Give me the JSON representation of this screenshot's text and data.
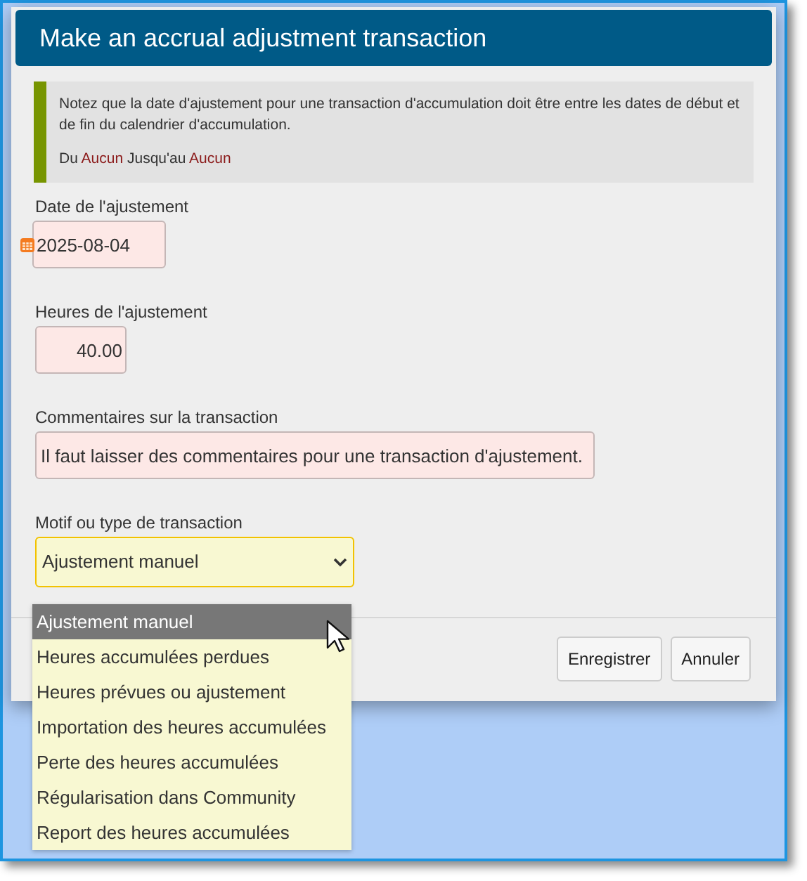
{
  "dialog": {
    "title": "Make an accrual adjustment transaction"
  },
  "notice": {
    "text": "Notez que la date d'ajustement pour une transaction d'accumulation doit être entre les dates de début et de fin du calendrier d'accumulation.",
    "range": [
      {
        "kind": "plain",
        "text": "Du"
      },
      {
        "kind": "value",
        "text": "Aucun"
      },
      {
        "kind": "plain",
        "text": "Jusqu'au"
      },
      {
        "kind": "value",
        "text": "Aucun"
      }
    ]
  },
  "fields": [
    {
      "kind": "date",
      "label": "Date de l'ajustement",
      "value": "2025-08-04"
    },
    {
      "kind": "number",
      "label": "Heures de l'ajustement",
      "value": "40.00"
    },
    {
      "kind": "text",
      "label": "Commentaires sur la transaction",
      "value": "Il faut laisser des commentaires pour une transaction d'ajustement."
    },
    {
      "kind": "select",
      "label": "Motif ou type de transaction",
      "value": "Ajustement manuel",
      "expanded": true
    }
  ],
  "options": [
    {
      "label": "Ajustement manuel",
      "selected": true
    },
    {
      "label": "Heures accumulées perdues",
      "selected": false
    },
    {
      "label": "Heures prévues ou ajustement",
      "selected": false
    },
    {
      "label": "Importation des heures accumulées",
      "selected": false
    },
    {
      "label": "Perte des heures accumulées",
      "selected": false
    },
    {
      "label": "Régularisation dans Community",
      "selected": false
    },
    {
      "label": "Report des heures accumulées",
      "selected": false
    }
  ],
  "buttons": [
    "Enregistrer",
    "Annuler"
  ]
}
